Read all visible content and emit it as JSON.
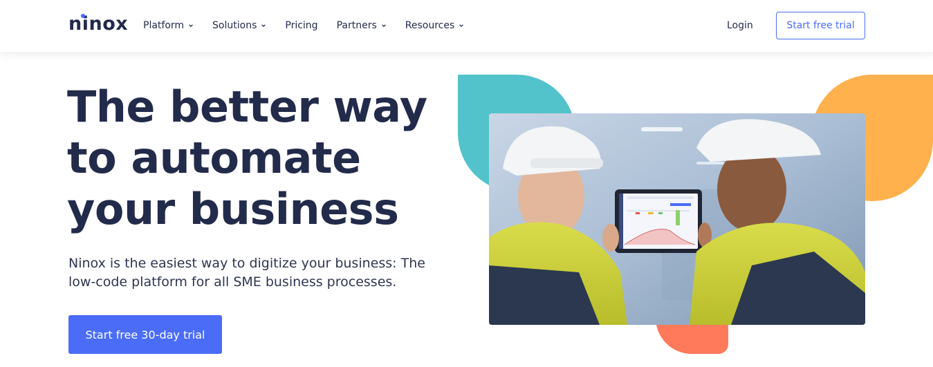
{
  "brand": {
    "name": "ninox"
  },
  "nav": {
    "items": [
      {
        "label": "Platform",
        "has_dropdown": true
      },
      {
        "label": "Solutions",
        "has_dropdown": true
      },
      {
        "label": "Pricing",
        "has_dropdown": false
      },
      {
        "label": "Partners",
        "has_dropdown": true
      },
      {
        "label": "Resources",
        "has_dropdown": true
      }
    ],
    "login_label": "Login",
    "trial_label": "Start free trial"
  },
  "hero": {
    "headline_line1": "The better way",
    "headline_line2": "to automate",
    "headline_line3": "your business",
    "subtitle": "Ninox is the easiest way to digitize your business: The low-code platform for all SME business processes.",
    "cta_label": "Start free 30-day trial"
  },
  "colors": {
    "accent": "#4a6cf7",
    "text_dark": "#232b4b",
    "blob_teal": "#52c3ca",
    "blob_orange": "#ffb14e",
    "blob_coral": "#ff7a5a"
  },
  "image": {
    "subject": "two workers in hard hats looking at a tablet dashboard"
  }
}
